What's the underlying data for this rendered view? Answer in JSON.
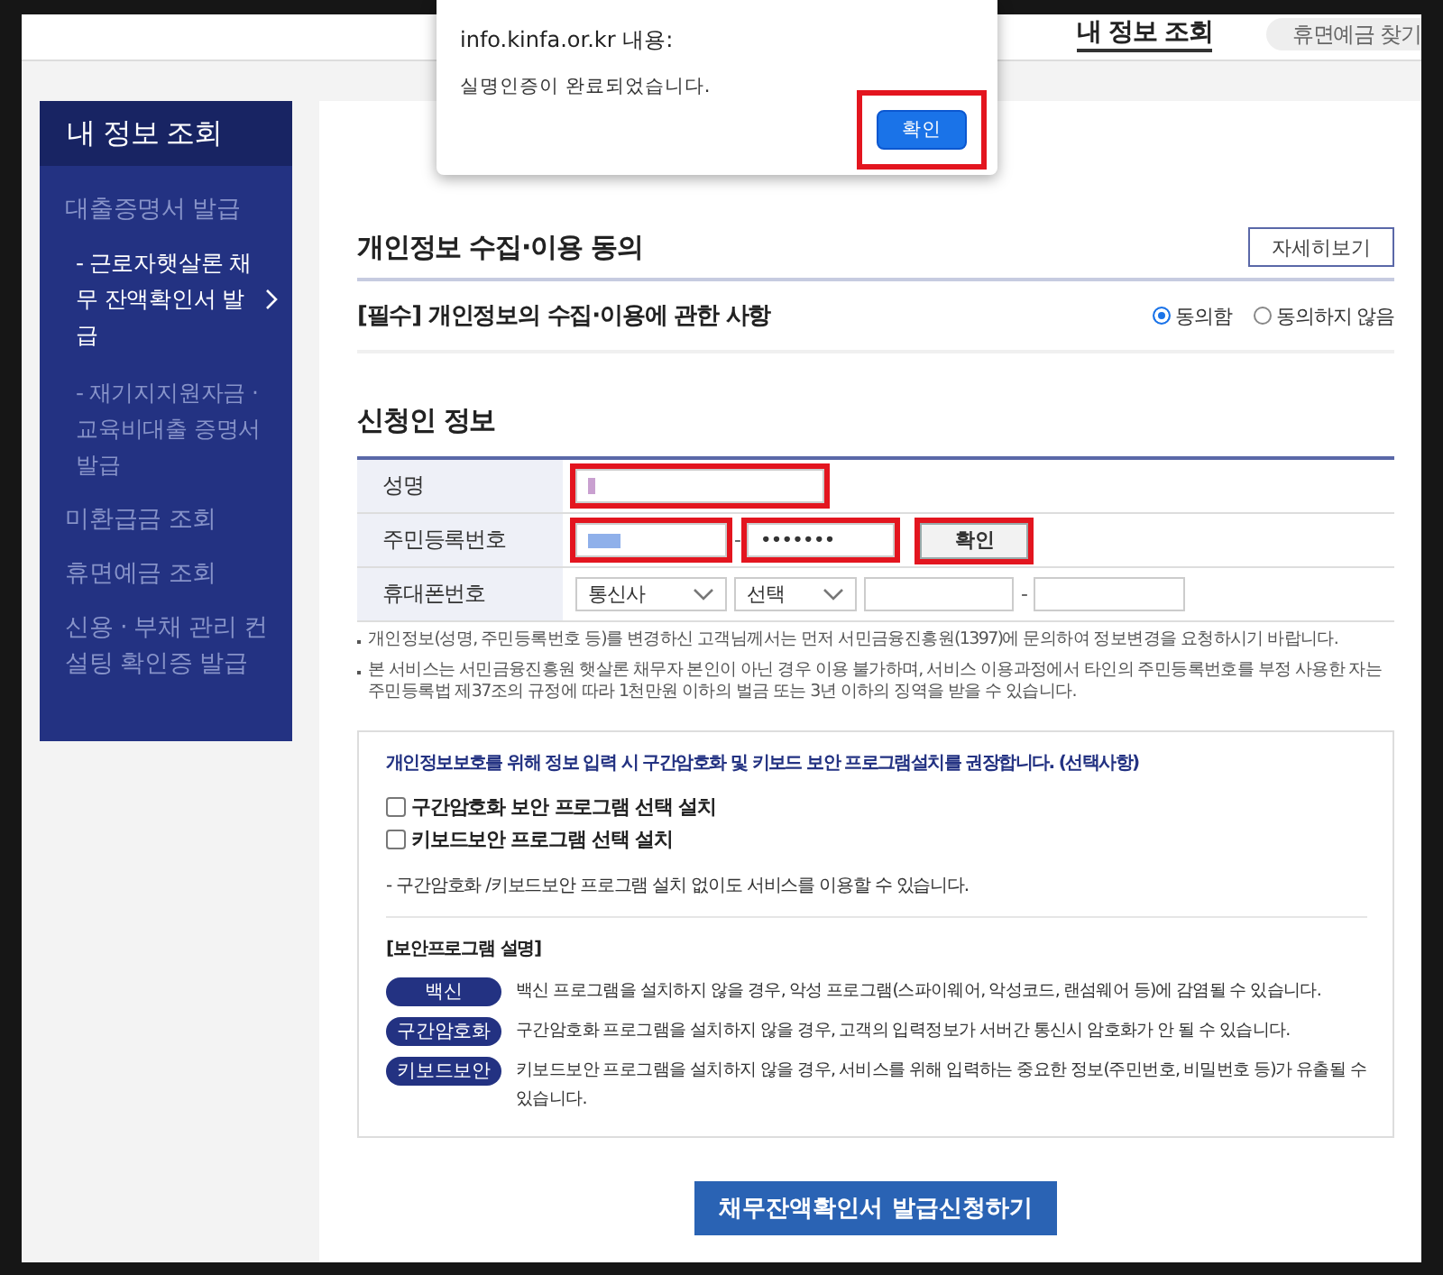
{
  "header": {
    "nav_item": "내 정보 조회",
    "button": "휴면예금 찾기"
  },
  "dialog": {
    "origin": "info.kinfa.or.kr 내용:",
    "message": "실명인증이 완료되었습니다.",
    "button": "확인",
    "highlighted": true
  },
  "sidebar": {
    "title": "내 정보 조회",
    "items": [
      {
        "label": "대출증명서 발급",
        "selected": false,
        "children": [
          {
            "label": "- 근로자햇살론 채무 잔액확인서 발급",
            "selected": true
          },
          {
            "label": "- 재기지지원자금 · 교육비대출 증명서 발급",
            "selected": false
          }
        ]
      },
      {
        "label": "미환급금 조회",
        "selected": false
      },
      {
        "label": "휴면예금 조회",
        "selected": false
      },
      {
        "label": "신용 · 부채 관리 컨설팅 확인증 발급",
        "selected": false
      }
    ]
  },
  "consent": {
    "title": "개인정보 수집·이용 동의",
    "details_button": "자세히보기",
    "item": "[필수] 개인정보의 수집·이용에 관한 사항",
    "options": [
      {
        "label": "동의함",
        "selected": true
      },
      {
        "label": "동의하지 않음",
        "selected": false
      }
    ]
  },
  "applicant": {
    "title": "신청인 정보",
    "rows": [
      {
        "label": "성명",
        "fields": [
          {
            "kind": "input",
            "redacted": true,
            "highlighted": true
          }
        ]
      },
      {
        "label": "주민등록번호",
        "fields": [
          {
            "kind": "input",
            "redacted": true,
            "highlighted": true
          },
          {
            "kind": "separator",
            "value": "-"
          },
          {
            "kind": "input",
            "value": "•••••••",
            "highlighted": true
          },
          {
            "kind": "button",
            "value": "확인",
            "highlighted": true
          }
        ]
      },
      {
        "label": "휴대폰번호",
        "fields": [
          {
            "kind": "select",
            "value": "통신사",
            "highlighted": false
          },
          {
            "kind": "select",
            "value": "선택",
            "highlighted": false
          },
          {
            "kind": "input",
            "highlighted": false
          },
          {
            "kind": "separator",
            "value": "-"
          },
          {
            "kind": "input",
            "highlighted": false
          }
        ]
      }
    ]
  },
  "notices": [
    "개인정보(성명, 주민등록번호 등)를 변경하신 고객님께서는 먼저 서민금융진흥원(1397)에 문의하여 정보변경을 요청하시기 바랍니다.",
    "본 서비스는 서민금융진흥원 햇살론 채무자 본인이 아닌 경우 이용 불가하며, 서비스 이용과정에서 타인의 주민등록번호를 부정 사용한 자는 주민등록법 제37조의 규정에 따라 1천만원 이하의 벌금 또는 3년 이하의 징역을 받을 수 있습니다."
  ],
  "security": {
    "intro": "개인정보보호를 위해 정보 입력 시 구간암호화 및 키보드 보안 프로그램설치를 권장합니다. (선택사항)",
    "checkboxes": [
      {
        "label": "구간암호화 보안 프로그램 선택 설치",
        "checked": false
      },
      {
        "label": "키보드보안 프로그램 선택 설치",
        "checked": false
      }
    ],
    "note": "- 구간암호화 /키보드보안 프로그램 설치 없이도 서비스를 이용할 수 있습니다.",
    "heading": "[보안프로그램 설명]",
    "programs": [
      {
        "tag": "백신",
        "text": "백신 프로그램을 설치하지 않을 경우, 악성 프로그램(스파이웨어, 악성코드, 랜섬웨어 등)에 감염될 수 있습니다."
      },
      {
        "tag": "구간암호화",
        "text": "구간암호화 프로그램을 설치하지 않을 경우, 고객의 입력정보가 서버간 통신시 암호화가 안 될 수 있습니다."
      },
      {
        "tag": "키보드보안",
        "text": "키보드보안 프로그램을 설치하지 않을 경우, 서비스를 위해 입력하는 중요한 정보(주민번호, 비밀번호 등)가 유출될 수 있습니다."
      }
    ]
  },
  "submit_button": "채무잔액확인서 발급신청하기"
}
